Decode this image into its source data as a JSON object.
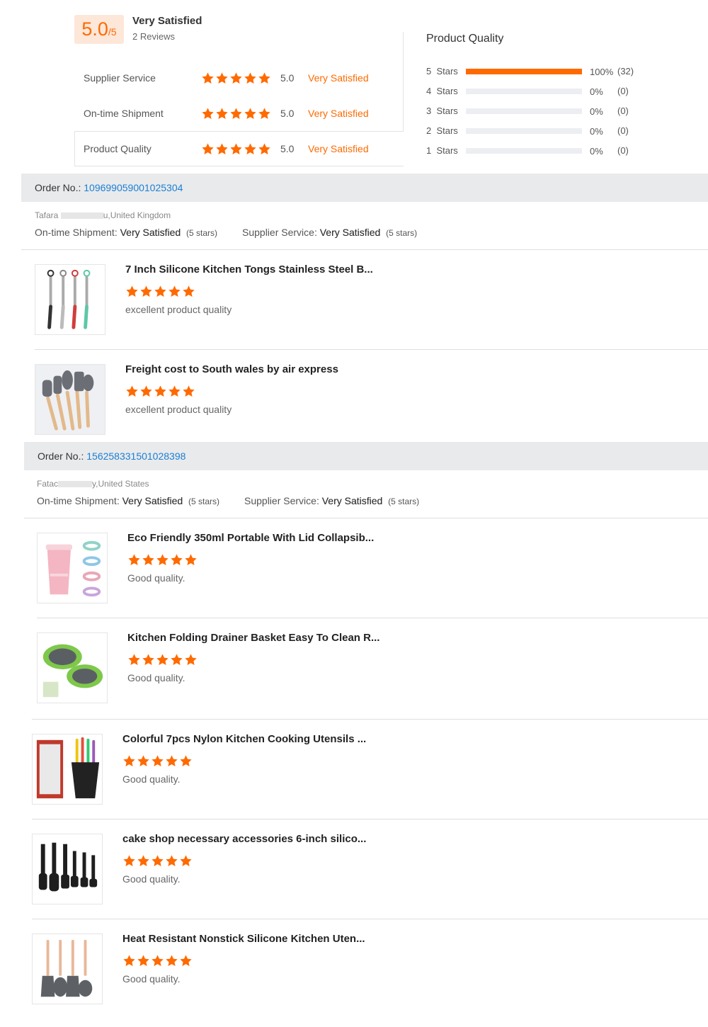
{
  "summary": {
    "score": "5.0",
    "score_suffix": "/5",
    "label": "Very Satisfied",
    "reviews": "2 Reviews",
    "criteria": [
      {
        "name": "Supplier Service",
        "score": "5.0",
        "label": "Very Satisfied",
        "stars": 5
      },
      {
        "name": "On-time Shipment",
        "score": "5.0",
        "label": "Very Satisfied",
        "stars": 5
      },
      {
        "name": "Product Quality",
        "score": "5.0",
        "label": "Very Satisfied",
        "stars": 5
      }
    ]
  },
  "product_quality": {
    "title": "Product Quality",
    "rows": [
      {
        "label": "5  Stars",
        "fraction": 1.0,
        "percent": "100%",
        "count": "(32)"
      },
      {
        "label": "4  Stars",
        "fraction": 0,
        "percent": "0%",
        "count": "(0)"
      },
      {
        "label": "3  Stars",
        "fraction": 0,
        "percent": "0%",
        "count": "(0)"
      },
      {
        "label": "2  Stars",
        "fraction": 0,
        "percent": "0%",
        "count": "(0)"
      },
      {
        "label": "1  Stars",
        "fraction": 0,
        "percent": "0%",
        "count": "(0)"
      }
    ]
  },
  "orders": [
    {
      "order_label": "Order No.: ",
      "order_no": "109699059001025304",
      "buyer_prefix": "Tafara",
      "buyer_suffix": "u,United Kingdom",
      "shipment_label": "On-time Shipment: ",
      "shipment_value": "Very Satisfied",
      "shipment_stars": "(5 stars)",
      "service_label": "Supplier Service: ",
      "service_value": "Very Satisfied",
      "service_stars": "(5 stars)",
      "items": [
        {
          "title": "7 Inch Silicone Kitchen Tongs Stainless Steel B...",
          "stars": 5,
          "comment": "excellent product quality",
          "thumb": "tongs"
        },
        {
          "title": "Freight cost to South wales by air express",
          "stars": 5,
          "comment": "excellent product quality",
          "thumb": "utensils-wood"
        }
      ]
    },
    {
      "order_label": "Order No.: ",
      "order_no": "156258331501028398",
      "buyer_prefix": "Fatac",
      "buyer_suffix": "y,United States",
      "shipment_label": "On-time Shipment: ",
      "shipment_value": "Very Satisfied",
      "shipment_stars": "(5 stars)",
      "service_label": "Supplier Service: ",
      "service_value": "Very Satisfied",
      "service_stars": "(5 stars)",
      "items": [
        {
          "title": "Eco Friendly 350ml Portable With Lid Collapsib...",
          "stars": 5,
          "comment": "Good quality.",
          "thumb": "cups"
        },
        {
          "title": "Kitchen Folding Drainer Basket Easy To Clean R...",
          "stars": 5,
          "comment": "Good quality.",
          "thumb": "drainer"
        },
        {
          "title": "Colorful 7pcs Nylon Kitchen Cooking Utensils ...",
          "stars": 5,
          "comment": "Good quality.",
          "thumb": "utensil-set"
        },
        {
          "title": "cake shop necessary accessories 6-inch silico...",
          "stars": 5,
          "comment": "Good quality.",
          "thumb": "spatulas-black"
        },
        {
          "title": "Heat Resistant Nonstick Silicone Kitchen Uten...",
          "stars": 5,
          "comment": "Good quality.",
          "thumb": "utensils-grey"
        }
      ]
    }
  ],
  "colors": {
    "accent": "#ff6a00",
    "link": "#1a7fd4",
    "order_bar": "#e9eaec",
    "score_bg": "#fde7d9"
  },
  "icons": {
    "rating_star": "star-icon"
  }
}
